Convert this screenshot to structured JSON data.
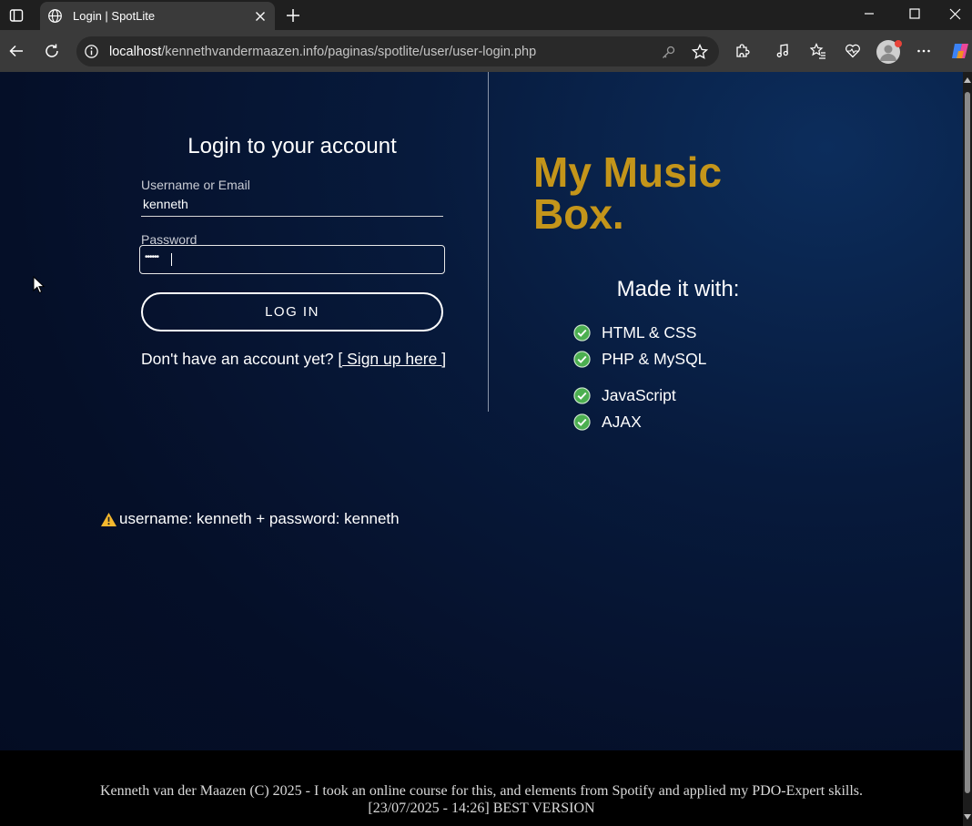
{
  "browser": {
    "tab_title": "Login | SpotLite",
    "url_host": "localhost",
    "url_path": "/kennethvandermaazen.info/paginas/spotlite/user/user-login.php"
  },
  "login": {
    "title": "Login to your account",
    "username_label": "Username or Email",
    "username_value": "kenneth",
    "password_label": "Password",
    "password_mask": "••••••",
    "button_label": "LOG IN",
    "signup_prompt": "Don't have an account yet? ",
    "signup_link": "[ Sign up here ]"
  },
  "hint": {
    "text": "username: kenneth + password: kenneth"
  },
  "brand": {
    "line1": "My Music",
    "line2": "Box."
  },
  "made_with": {
    "title": "Made it with:",
    "items": [
      "HTML & CSS",
      "PHP & MySQL",
      "JavaScript",
      "AJAX"
    ]
  },
  "footer": {
    "line1": "Kenneth van der Maazen (C) 2025 - I took an online course for this, and elements from Spotify and applied my PDO-Expert skills.",
    "line2": "[23/07/2025 - 14:26] BEST VERSION"
  },
  "colors": {
    "brand_gold": "#c4951a",
    "page_bg": "#050f28",
    "check_green": "#4caf50",
    "warning_yellow": "#f5b82e"
  }
}
